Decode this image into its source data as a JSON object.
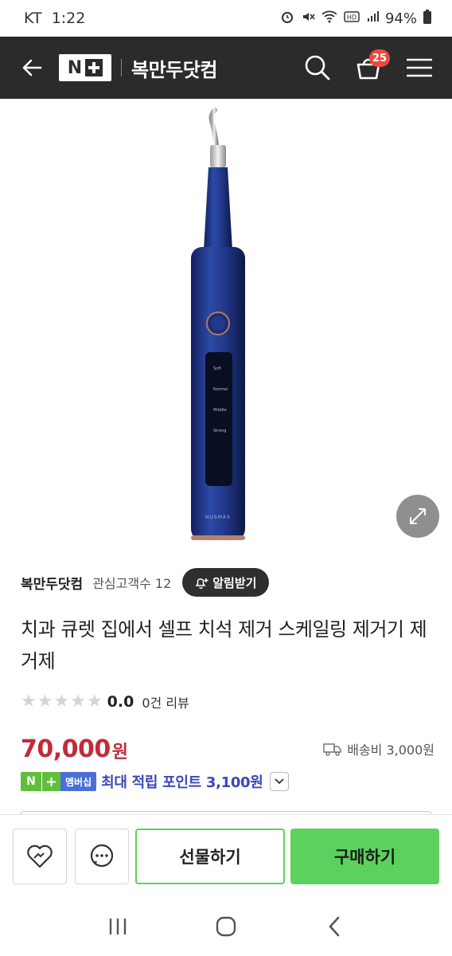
{
  "status_bar": {
    "carrier": "KT",
    "time": "1:22",
    "battery": "94%"
  },
  "header": {
    "logo_letter": "N",
    "store_name": "복만두닷컴",
    "cart_count": "25"
  },
  "seller": {
    "name": "복만두닷컴",
    "interest_label": "관심고객수 12",
    "alarm_label": "알림받기"
  },
  "product": {
    "title": "치과 큐렛 집에서 셀프 치석 제거 스케일링 제거기 제거제",
    "rating": "0.0",
    "rating_fraction": 0,
    "review_count": "0건 리뷰",
    "price": "70,000",
    "currency": "원",
    "shipping": "배송비 3,000원",
    "device_brand": "HUSMAX",
    "device_modes": [
      "Soft",
      "Normal",
      "Middle",
      "Strong"
    ]
  },
  "points": {
    "badge_n": "N",
    "badge_label": "멤버십",
    "text": "최대 적립 포인트 3,100원"
  },
  "actions": {
    "gift_label": "선물하기",
    "buy_label": "구매하기"
  },
  "colors": {
    "header_bg": "#2b2b2b",
    "price": "#c32a38",
    "points": "#3c46b8",
    "buy_green": "#5cd15e",
    "badge_red": "#f0483e"
  },
  "icons": {
    "back": "arrow-left-icon",
    "search": "search-icon",
    "cart": "cart-icon",
    "menu": "hamburger-menu-icon",
    "expand": "expand-icon",
    "bell": "bell-plus-icon",
    "shipping": "truck-icon",
    "like": "heart-icon",
    "talk": "chat-icon",
    "chevron": "chevron-down-icon"
  }
}
